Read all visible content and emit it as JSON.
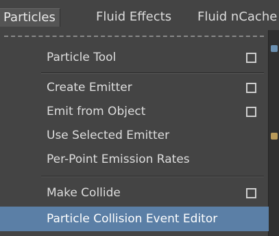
{
  "menubar": {
    "items": [
      {
        "label": "Particles",
        "active": true
      },
      {
        "label": "Fluid Effects",
        "active": false
      },
      {
        "label": "Fluid nCache",
        "active": false
      }
    ]
  },
  "menu": {
    "items": [
      {
        "label": "Particle Tool",
        "option_box": true
      },
      {
        "label": "Create Emitter",
        "option_box": true
      },
      {
        "label": "Emit from Object",
        "option_box": true
      },
      {
        "label": "Use Selected Emitter",
        "option_box": false
      },
      {
        "label": "Per-Point Emission Rates",
        "option_box": false
      },
      {
        "label": "Make Collide",
        "option_box": true
      },
      {
        "label": "Particle Collision Event Editor",
        "option_box": false,
        "highlighted": true
      }
    ]
  },
  "colors": {
    "menu_bg": "#444444",
    "highlight": "#5b7fa6",
    "text": "#dedede"
  },
  "icons": {
    "option_box": "option-box-icon"
  }
}
